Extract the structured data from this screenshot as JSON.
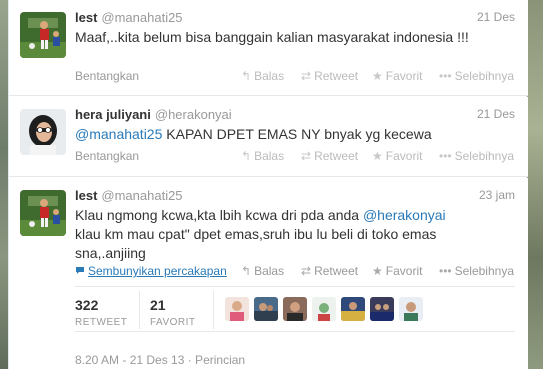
{
  "tweets": [
    {
      "fullname": "lest",
      "username": "@manahati25",
      "time": "21 Des",
      "text": "Maaf,..kita belum bisa banggain kalian masyarakat indonesia !!!",
      "expand": "Bentangkan"
    },
    {
      "fullname": "hera juliyani",
      "username": "@herakonyai",
      "time": "21 Des",
      "mention": "@manahati25",
      "text_rest": " KAPAN DPET EMAS NY bnyak yg kecewa",
      "expand": "Bentangkan"
    },
    {
      "fullname": "lest",
      "username": "@manahati25",
      "time": "23 jam",
      "text_before": "Klau ngmong kcwa,kta lbih kcwa dri pda anda ",
      "mention": "@herakonyai",
      "text_after": " klau km mau cpat\" dpet emas,sruh ibu lu beli di toko emas sna,.anjiing",
      "hide_convo": "Sembunyikan percakapan",
      "retweet_count": "322",
      "retweet_label": "RETWEET",
      "favorite_count": "21",
      "favorite_label": "FAVORIT",
      "meta": "8.20 AM - 21 Des 13 · Perincian"
    }
  ],
  "actions": {
    "reply": "Balas",
    "retweet": "Retweet",
    "favorite": "Favorit",
    "more": "Selebihnya"
  },
  "icons": {
    "reply": "reply-icon",
    "retweet": "retweet-icon",
    "favorite": "star-icon",
    "more": "more-dots-icon",
    "conversation": "conversation-icon"
  },
  "colors": {
    "link": "#2a7ab8",
    "muted": "#999999",
    "text": "#333333"
  }
}
